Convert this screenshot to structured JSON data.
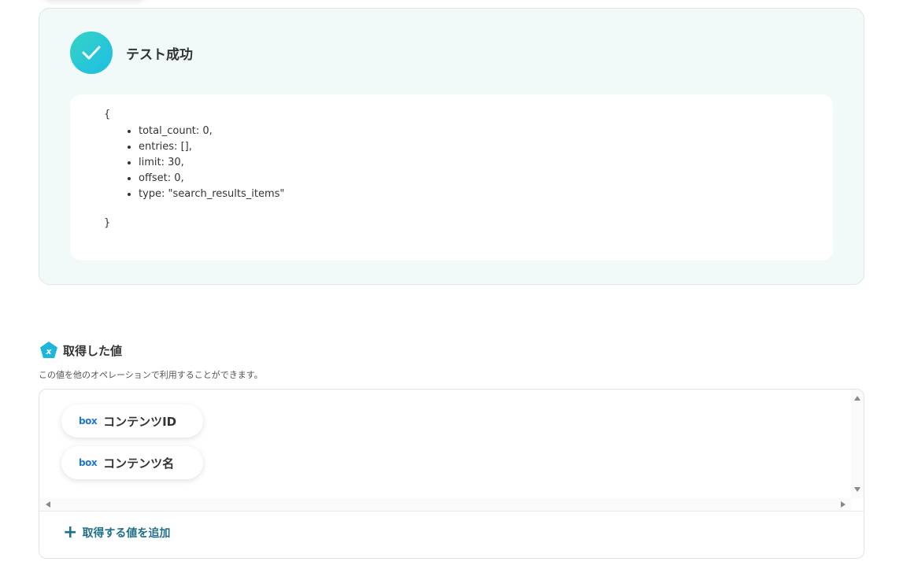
{
  "success": {
    "title": "テスト成功",
    "icon": "check-icon",
    "open_brace": "{",
    "close_brace": "}",
    "items": [
      "total_count: 0,",
      "entries: [],",
      "limit: 30,",
      "offset: 0,",
      "type: \"search_results_items\""
    ]
  },
  "acquired": {
    "icon": "variable-pentagon-icon",
    "title": "取得した値",
    "description": "この値を他のオペレーションで利用することができます。",
    "chips": [
      {
        "logo": "box",
        "label": "コンテンツID"
      },
      {
        "logo": "box",
        "label": "コンテンツ名"
      }
    ],
    "add_label": "取得する値を追加"
  },
  "colors": {
    "accent": "#1f6f8b",
    "success_gradient_start": "#35d3c4",
    "success_gradient_end": "#1dbde6",
    "box_brand": "#1d78d6",
    "panel_bg": "#f2faf9"
  }
}
